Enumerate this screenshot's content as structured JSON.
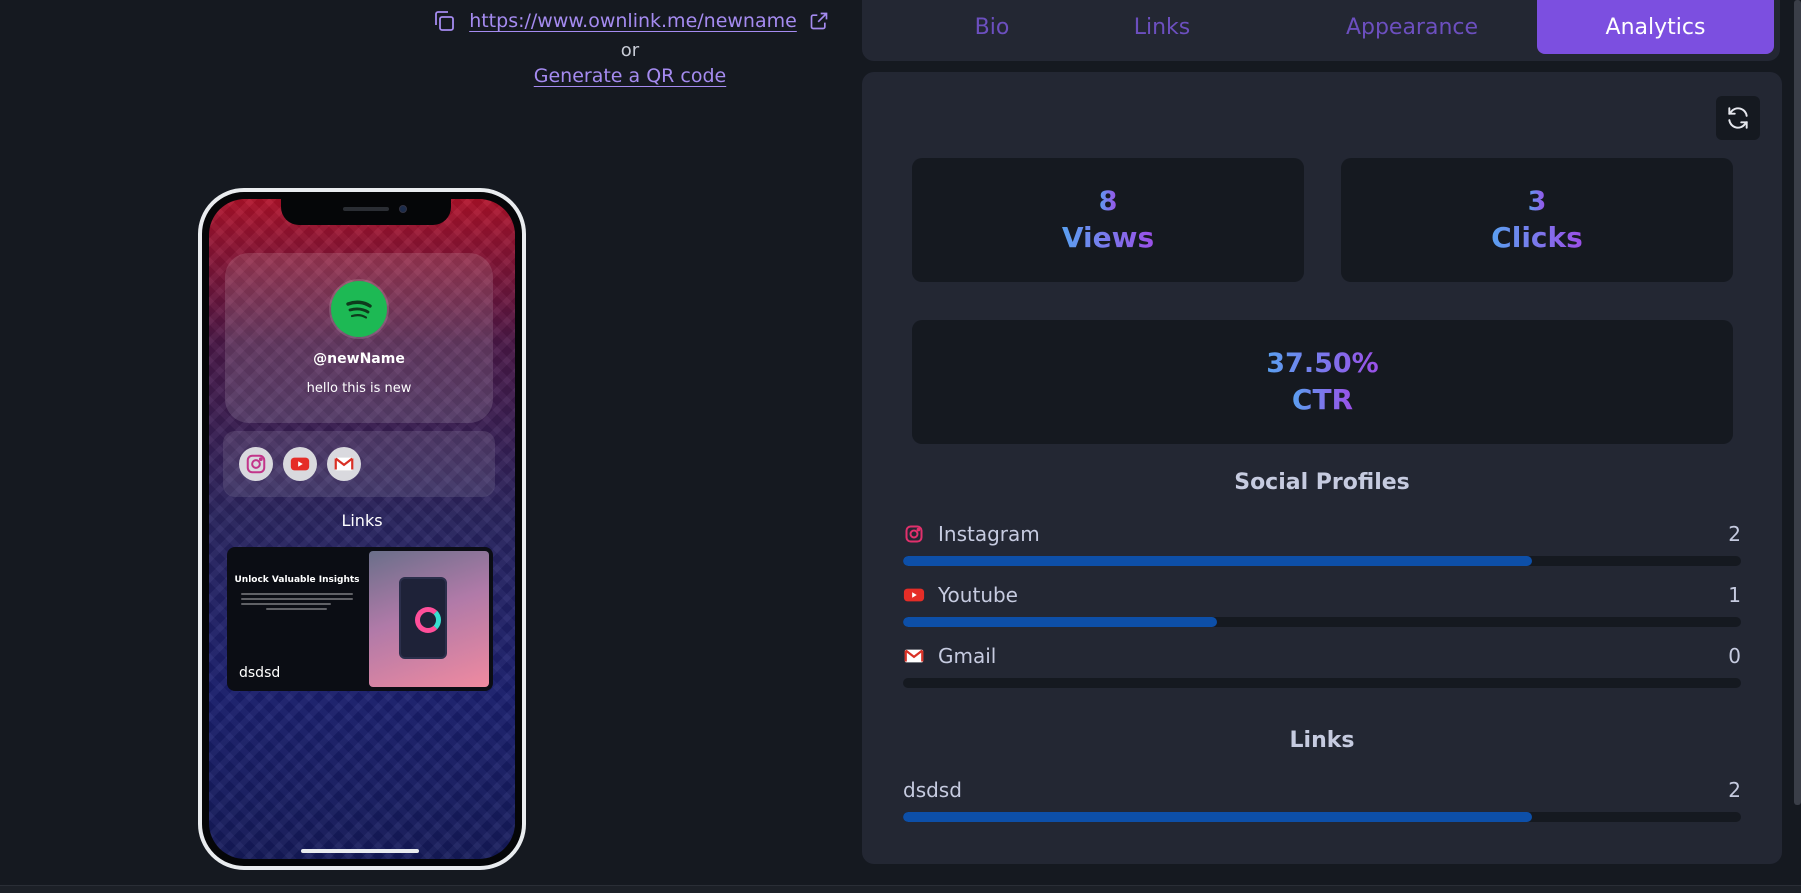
{
  "share": {
    "url": "https://www.ownlink.me/newname",
    "or_text": "or",
    "qr_label": "Generate a QR code"
  },
  "preview": {
    "handle": "@newName",
    "bio": "hello this is new",
    "social_icons": [
      "instagram-icon",
      "youtube-icon",
      "gmail-icon"
    ],
    "links_title": "Links",
    "link_card": {
      "thumb_heading": "Unlock Valuable Insights",
      "label": "dsdsd"
    }
  },
  "tabs": [
    {
      "label": "Bio",
      "active": false
    },
    {
      "label": "Links",
      "active": false
    },
    {
      "label": "Appearance",
      "active": false
    },
    {
      "label": "Analytics",
      "active": true
    }
  ],
  "stats": {
    "views": {
      "value": "8",
      "label": "Views"
    },
    "clicks": {
      "value": "3",
      "label": "Clicks"
    },
    "ctr": {
      "value": "37.50%",
      "label": "CTR"
    }
  },
  "social_profiles": {
    "title": "Social Profiles",
    "items": [
      {
        "name": "Instagram",
        "count": "2",
        "fraction": 0.75,
        "icon": "instagram-icon"
      },
      {
        "name": "Youtube",
        "count": "1",
        "fraction": 0.375,
        "icon": "youtube-icon"
      },
      {
        "name": "Gmail",
        "count": "0",
        "fraction": 0,
        "icon": "gmail-icon"
      }
    ]
  },
  "links": {
    "title": "Links",
    "items": [
      {
        "name": "dsdsd",
        "count": "2",
        "fraction": 0.75
      }
    ]
  },
  "colors": {
    "accent": "#7c4fe0",
    "bar": "#0d4fa8",
    "background": "#151920",
    "panel": "#232733"
  }
}
